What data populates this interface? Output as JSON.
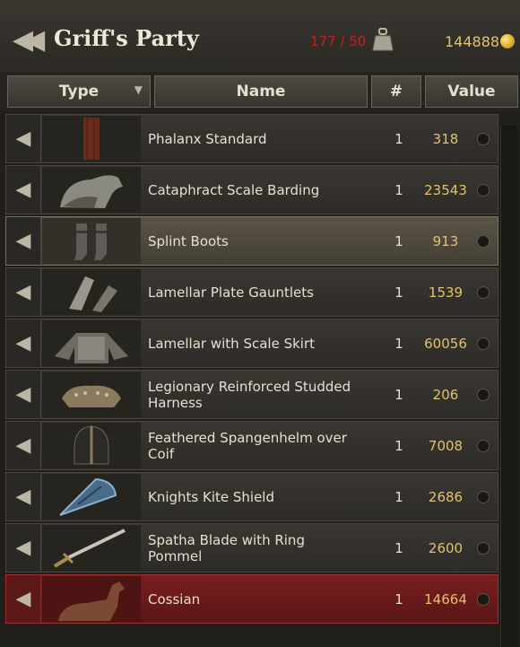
{
  "header": {
    "title": "Griff's Party",
    "weight_text": "177 / 50",
    "gold": "144888",
    "weight_icon": "weight-icon",
    "coin_icon": "gold-coin-icon",
    "weight_color": "#c02020",
    "gold_color": "#e3c26e"
  },
  "columns": {
    "type": "Type",
    "name": "Name",
    "qty": "#",
    "value": "Value"
  },
  "items": [
    {
      "name": "Phalanx Standard",
      "qty": "1",
      "value": "318",
      "icon": "banner-icon",
      "state": "normal"
    },
    {
      "name": "Cataphract Scale Barding",
      "qty": "1",
      "value": "23543",
      "icon": "horse-barding-icon",
      "state": "normal"
    },
    {
      "name": "Splint Boots",
      "qty": "1",
      "value": "913",
      "icon": "boots-icon",
      "state": "highlighted"
    },
    {
      "name": "Lamellar Plate Gauntlets",
      "qty": "1",
      "value": "1539",
      "icon": "gauntlets-icon",
      "state": "normal"
    },
    {
      "name": "Lamellar with Scale Skirt",
      "qty": "1",
      "value": "60056",
      "icon": "body-armor-icon",
      "state": "normal"
    },
    {
      "name": "Legionary Reinforced Studded Harness",
      "qty": "1",
      "value": "206",
      "icon": "harness-icon",
      "state": "normal"
    },
    {
      "name": "Feathered Spangenhelm over Coif",
      "qty": "1",
      "value": "7008",
      "icon": "helmet-icon",
      "state": "normal"
    },
    {
      "name": "Knights Kite Shield",
      "qty": "1",
      "value": "2686",
      "icon": "shield-icon",
      "state": "normal"
    },
    {
      "name": "Spatha Blade with Ring Pommel",
      "qty": "1",
      "value": "2600",
      "icon": "sword-icon",
      "state": "normal"
    },
    {
      "name": "Cossian",
      "qty": "1",
      "value": "14664",
      "icon": "horse-icon",
      "state": "selected"
    }
  ]
}
